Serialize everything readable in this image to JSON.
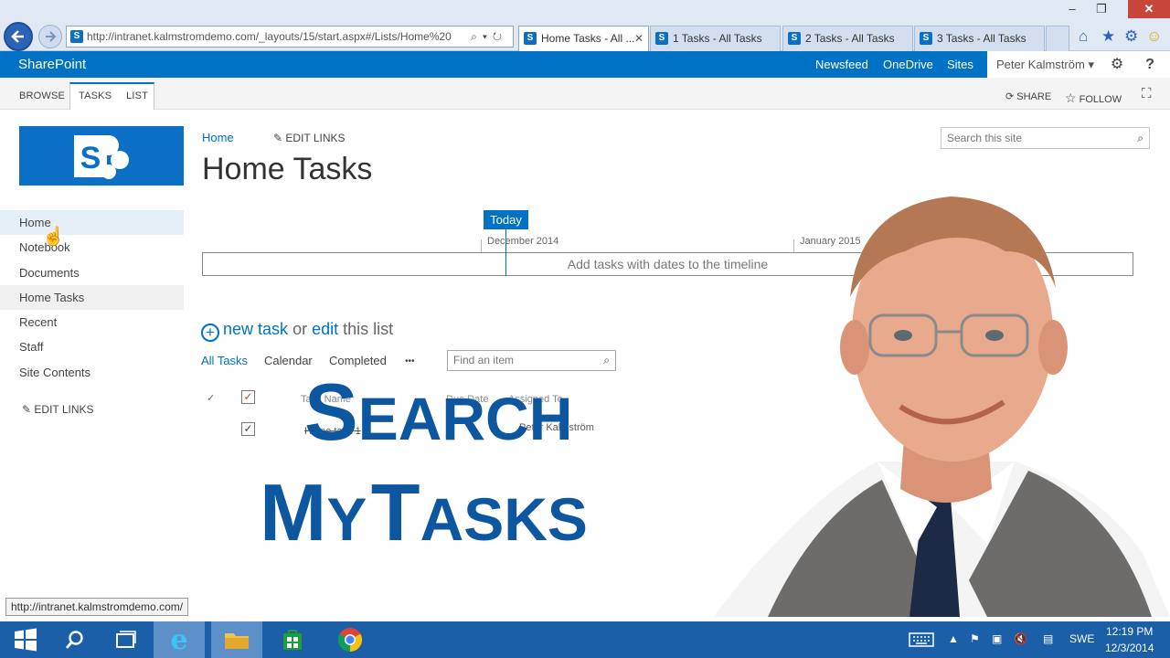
{
  "browser": {
    "address": "http://intranet.kalmstromdemo.com/_layouts/15/start.aspx#/Lists/Home%20",
    "address_domain": "kalmstromdemo.com",
    "tabs": [
      {
        "label": "Home Tasks - All ...",
        "active": true
      },
      {
        "label": "1 Tasks - All Tasks",
        "active": false
      },
      {
        "label": "2 Tasks - All Tasks",
        "active": false
      },
      {
        "label": "3 Tasks - All Tasks",
        "active": false
      }
    ],
    "status_url": "http://intranet.kalmstromdemo.com/"
  },
  "suite": {
    "brand": "SharePoint",
    "links": [
      "Newsfeed",
      "OneDrive",
      "Sites"
    ],
    "user": "Peter Kalmström"
  },
  "ribbon": {
    "tabs": [
      "BROWSE",
      "TASKS",
      "LIST"
    ],
    "share": "SHARE",
    "follow": "FOLLOW"
  },
  "nav": {
    "items": [
      "Home",
      "Notebook",
      "Documents",
      "Home Tasks",
      "Recent",
      "Staff",
      "Site Contents"
    ],
    "edit_links": "EDIT LINKS"
  },
  "main": {
    "breadcrumb": "Home",
    "edit_links": "EDIT LINKS",
    "title": "Home Tasks",
    "search_placeholder": "Search this site",
    "timeline": {
      "today": "Today",
      "dates": [
        "December 2014",
        "January 2015"
      ],
      "empty_text": "Add tasks with dates to the timeline"
    },
    "new_task": "new task",
    "or": "or",
    "edit": "edit",
    "this_list": "this list",
    "views": [
      "All Tasks",
      "Calendar",
      "Completed"
    ],
    "more": "•••",
    "find_placeholder": "Find an item",
    "columns": [
      "Task Name",
      "Due Date",
      "Assigned To"
    ],
    "row": {
      "task": "Home task 1",
      "assigned": "Peter Kalmström"
    }
  },
  "overlay": {
    "line1_cap": "S",
    "line1_rest": "EARCH",
    "line2_cap1": "M",
    "line2_rest1": "Y",
    "line2_cap2": "T",
    "line2_rest2": "ASKS"
  },
  "taskbar": {
    "lang": "SWE",
    "time": "12:19 PM",
    "date": "12/3/2014"
  }
}
